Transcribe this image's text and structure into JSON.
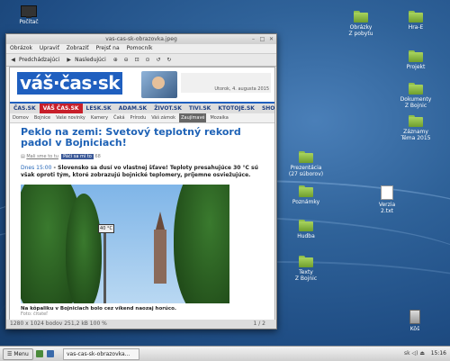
{
  "desktop": {
    "icons": [
      {
        "label": "Počítač",
        "kind": "monitor"
      },
      {
        "label": "Obrázky\nZ pobytu",
        "kind": "folder"
      },
      {
        "label": "Hra-E",
        "kind": "folder"
      },
      {
        "label": "Projekt",
        "kind": "folder"
      },
      {
        "label": "Dokumenty\nZ Bojnic",
        "kind": "folder"
      },
      {
        "label": "Záznamy\nTéma 2015",
        "kind": "folder"
      },
      {
        "label": "Prezentácia\n(27 súborov)",
        "kind": "folder"
      },
      {
        "label": "Poznámky",
        "kind": "folder"
      },
      {
        "label": "Hudba",
        "kind": "folder"
      },
      {
        "label": "Texty\nZ Bojnic",
        "kind": "folder"
      },
      {
        "label": "Verzia\n2.txt",
        "kind": "doc"
      },
      {
        "label": "Kôš",
        "kind": "trash"
      }
    ]
  },
  "window": {
    "title": "vas-cas-sk-obrazovka.jpeg",
    "menu": [
      "Obrázok",
      "Upraviť",
      "Zobraziť",
      "Prejsť na",
      "Pomocník"
    ],
    "toolbar": {
      "prev": "Predchádzajúci",
      "next": "Nasledujúci"
    },
    "status_left": "1280 x 1024 bodov  251,2 kB  100 %",
    "status_right": "1 / 2"
  },
  "site": {
    "logo": "váš·čas·sk",
    "header_date": "Utorok, 4. augusta 2015",
    "nav_main": [
      "ČAS.SK",
      "VÁŠ ČAS.SK",
      "LESK.SK",
      "ADAM.SK",
      "ŽIVOT.SK",
      "TIVI.SK",
      "KTOTOJE.SK",
      "SHOPPING"
    ],
    "nav_main_active": 1,
    "nav_sub": [
      "Domov",
      "Bojnice",
      "Vaše novinky",
      "Kamery",
      "Čaká",
      "Prírodu",
      "Váš zámok",
      "Zaujímavé",
      "Mozaika"
    ],
    "nav_sub_active": 7,
    "article": {
      "title": "Peklo na zemi: Svetový teplotný rekord padol v Bojniciach!",
      "meta_author": "Mali sme to tu",
      "meta_fb": "Páči sa mi to",
      "meta_count": "68",
      "time": "Dnes 15:00",
      "lead": " - Slovensko sa dusí vo vlastnej šťave! Teploty presahujúce 30 °C sú však oproti tým, ktoré zobrazujú bojnické teplomery, príjemne osviežujúce.",
      "photo_sign": "40 °C",
      "caption": "Na kôpaliku v Bojniciach bolo cez víkend naozaj horúco.",
      "caption_credit": "Foto: čitateľ"
    }
  },
  "taskbar": {
    "menu_label": "Menu",
    "task_label": "vas-cas-sk-obrazovka...",
    "tray": "sk  ◁)  ⏏",
    "clock": "15:16"
  },
  "colors": {
    "brand_blue": "#1f5fbf",
    "nav_active_red": "#c81f2a",
    "title_blue": "#1e62b6",
    "desktop_blue": "#2f6299"
  }
}
